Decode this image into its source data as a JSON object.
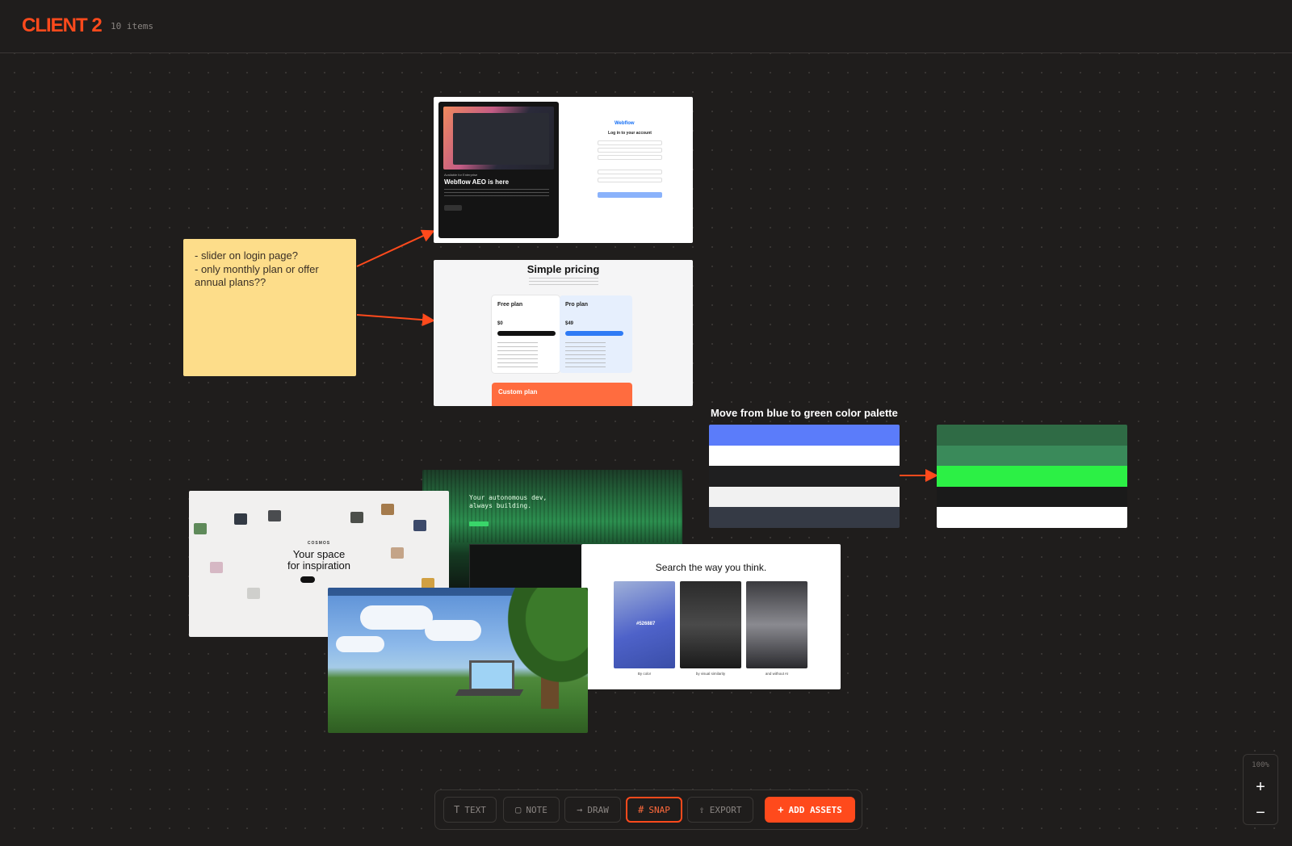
{
  "header": {
    "title": "CLIENT 2",
    "item_count": "10 items"
  },
  "note": {
    "text": "- slider on login page?\n- only monthly plan or offer annual plans??"
  },
  "webflow_card": {
    "label": "Available for Enterprise",
    "headline": "Webflow AEO is here",
    "logo": "Webflow",
    "login_title": "Log in to your account"
  },
  "pricing_card": {
    "title": "Simple pricing",
    "free_plan": "Free plan",
    "free_price": "$0",
    "pro_plan": "Pro plan",
    "pro_price": "$49",
    "custom_plan": "Custom plan"
  },
  "palette": {
    "title": "Move from blue to green color palette",
    "from_colors": [
      "#5b7cfa",
      "#ffffff",
      "#1f1f20",
      "#f1f1f1",
      "#353a45"
    ],
    "to_colors": [
      "#2f6b45",
      "#3a8a5a",
      "#2cf045",
      "#1a1a1a",
      "#ffffff"
    ]
  },
  "cosmos_card": {
    "brand": "COSMOS",
    "headline": "Your space\nfor inspiration"
  },
  "dev_card": {
    "headline": "Your autonomous dev,\nalways building."
  },
  "search_card": {
    "headline": "Search the way you think.",
    "hex": "#526887",
    "captions": [
      "By color",
      "by visual similarity",
      "and without AI"
    ]
  },
  "zoom": {
    "level": "100%",
    "zoom_in": "+",
    "zoom_out": "−"
  },
  "toolbar": {
    "text": "TEXT",
    "note": "NOTE",
    "draw": "DRAW",
    "snap": "SNAP",
    "export": "EXPORT",
    "add_assets": "ADD ASSETS"
  },
  "colors": {
    "accent": "#ff4a1c",
    "note_bg": "#fddd8a",
    "canvas_bg": "#1f1d1c"
  }
}
